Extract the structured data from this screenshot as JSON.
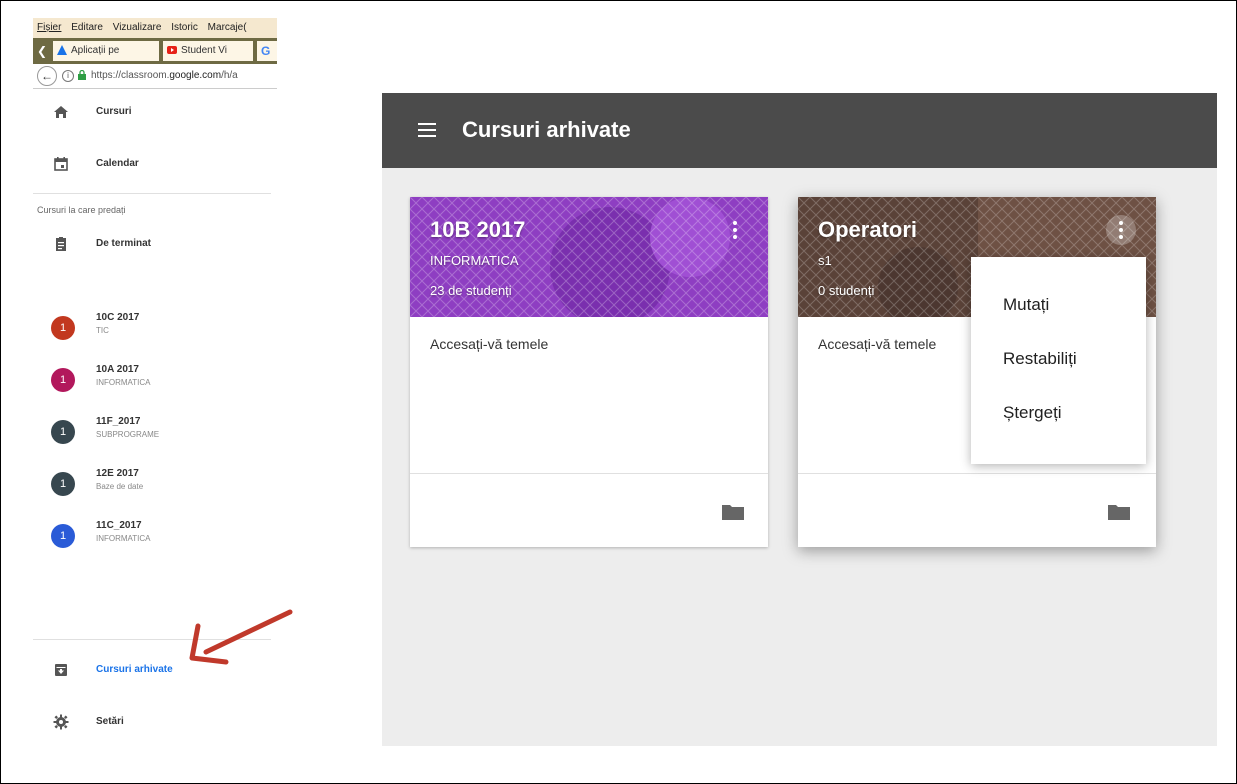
{
  "browser": {
    "menu": [
      "Fișier",
      "Editare",
      "Vizualizare",
      "Istoric",
      "Marcaje("
    ],
    "tabs": [
      {
        "label": "Aplicații pe",
        "icon": "app-icon"
      },
      {
        "label": "Student Vi",
        "icon": "youtube-icon"
      },
      {
        "label": "G",
        "icon": "google-icon"
      }
    ],
    "url_prefix": "https://classroom.",
    "url_domain": "google.com",
    "url_suffix": "/h/a"
  },
  "sidebar": {
    "items_top": [
      {
        "label": "Cursuri",
        "icon": "home-icon"
      },
      {
        "label": "Calendar",
        "icon": "calendar-icon"
      }
    ],
    "section_label": "Cursuri la care predați",
    "todo_label": "De terminat",
    "courses": [
      {
        "badge": "1",
        "title": "10C 2017",
        "subtitle": "TIC",
        "color": "#c2381f"
      },
      {
        "badge": "1",
        "title": "10A 2017",
        "subtitle": "INFORMATICA",
        "color": "#b2185c"
      },
      {
        "badge": "1",
        "title": "11F_2017",
        "subtitle": "SUBPROGRAME",
        "color": "#37474f"
      },
      {
        "badge": "1",
        "title": "12E 2017",
        "subtitle": "Baze de date",
        "color": "#37474f"
      },
      {
        "badge": "1",
        "title": "11C_2017",
        "subtitle": "INFORMATICA",
        "color": "#2a5bd7"
      }
    ],
    "archived_label": "Cursuri arhivate",
    "settings_label": "Setări"
  },
  "header": {
    "title": "Cursuri arhivate"
  },
  "cards": [
    {
      "title": "10B 2017",
      "subtitle": "INFORMATICA",
      "students": "23 de studenți",
      "link": "Accesați-vă temele",
      "color": "#8e3ec2"
    },
    {
      "title": "Operatori",
      "subtitle": "s1",
      "students": "0 studenți",
      "link": "Accesați-vă temele",
      "color": "#5a4238"
    }
  ],
  "menu": {
    "items": [
      "Mutați",
      "Restabiliți",
      "Ștergeți"
    ]
  },
  "colors": {
    "accent": "#1a73e8",
    "topbar": "#4b4b4b",
    "annotation_arrow": "#c0392b"
  }
}
